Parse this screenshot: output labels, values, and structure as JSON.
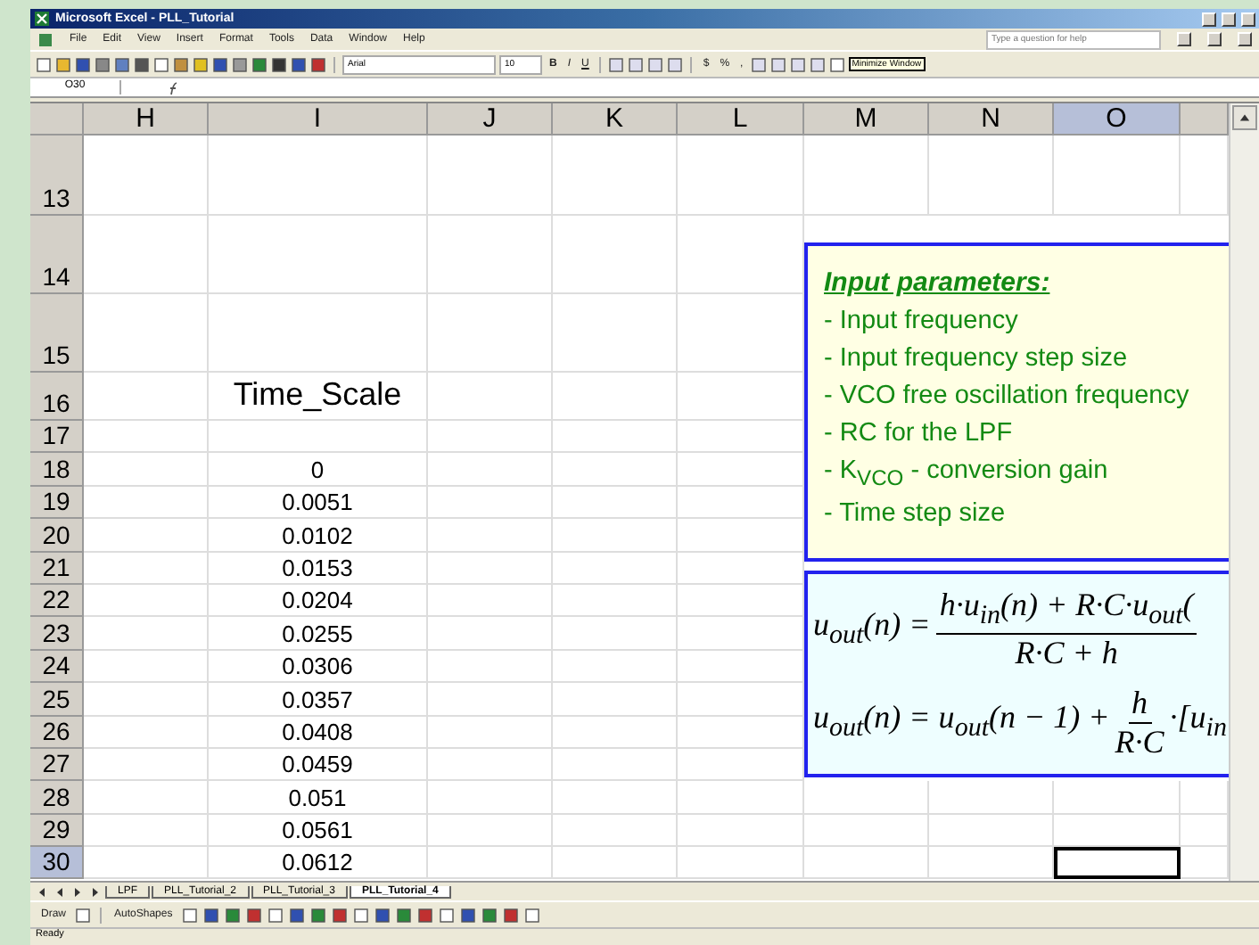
{
  "window": {
    "title": "Microsoft Excel - PLL_Tutorial"
  },
  "menu": [
    "File",
    "Edit",
    "View",
    "Insert",
    "Format",
    "Tools",
    "Data",
    "Window",
    "Help"
  ],
  "help_box": {
    "placeholder": "Type a question for help"
  },
  "formatting": {
    "font": "Arial",
    "size": "10",
    "bold": "B",
    "italic": "I",
    "underline": "U",
    "currency": "$",
    "percent": "%",
    "comma": ","
  },
  "tooltip": "Minimize Window",
  "name_box": "O30",
  "columns": [
    {
      "label": "H",
      "selected": false
    },
    {
      "label": "I",
      "selected": false
    },
    {
      "label": "J",
      "selected": false
    },
    {
      "label": "K",
      "selected": false
    },
    {
      "label": "L",
      "selected": false
    },
    {
      "label": "M",
      "selected": false
    },
    {
      "label": "N",
      "selected": false
    },
    {
      "label": "O",
      "selected": true
    }
  ],
  "rows": [
    {
      "label": "13",
      "selected": false
    },
    {
      "label": "14",
      "selected": false
    },
    {
      "label": "15",
      "selected": false
    },
    {
      "label": "16",
      "selected": false,
      "value": "Time_Scale",
      "kind": "heading"
    },
    {
      "label": "17",
      "selected": false
    },
    {
      "label": "18",
      "selected": false,
      "value": "0",
      "kind": "number"
    },
    {
      "label": "19",
      "selected": false,
      "value": "0.0051",
      "kind": "number"
    },
    {
      "label": "20",
      "selected": false,
      "value": "0.0102",
      "kind": "number"
    },
    {
      "label": "21",
      "selected": false,
      "value": "0.0153",
      "kind": "number"
    },
    {
      "label": "22",
      "selected": false,
      "value": "0.0204",
      "kind": "number"
    },
    {
      "label": "23",
      "selected": false,
      "value": "0.0255",
      "kind": "number"
    },
    {
      "label": "24",
      "selected": false,
      "value": "0.0306",
      "kind": "number"
    },
    {
      "label": "25",
      "selected": false,
      "value": "0.0357",
      "kind": "number"
    },
    {
      "label": "26",
      "selected": false,
      "value": "0.0408",
      "kind": "number"
    },
    {
      "label": "27",
      "selected": false,
      "value": "0.0459",
      "kind": "number"
    },
    {
      "label": "28",
      "selected": false,
      "value": "0.051",
      "kind": "number"
    },
    {
      "label": "29",
      "selected": false,
      "value": "0.0561",
      "kind": "number"
    },
    {
      "label": "30",
      "selected": true,
      "value": "0.0612",
      "kind": "number"
    }
  ],
  "text_box": {
    "title": "Input parameters:",
    "items": [
      "- Input frequency",
      "- Input frequency step size",
      "- VCO free oscillation frequency",
      "- RC for the LPF",
      "- K$_{VCO}$ - conversion gain",
      "- Time step size"
    ]
  },
  "equations": [
    {
      "left": "u$_{out}$(n) =",
      "numerator": "h·u$_{in}$(n) + R·C·u$_{out}$(",
      "denominator": "R·C + h"
    },
    {
      "left": "u$_{out}$(n) = u$_{out}$(n − 1) +",
      "numerator": "h",
      "denominator": "R·C",
      "right": "·[u$_{in}$"
    }
  ],
  "sheet_tabs": [
    {
      "label": "LPF",
      "selected": false
    },
    {
      "label": "PLL_Tutorial_2",
      "selected": false
    },
    {
      "label": "PLL_Tutorial_3",
      "selected": false
    },
    {
      "label": "PLL_Tutorial_4",
      "selected": true
    }
  ],
  "draw_toolbar": {
    "draw": "Draw",
    "autoshapes": "AutoShapes"
  },
  "status": "Ready"
}
